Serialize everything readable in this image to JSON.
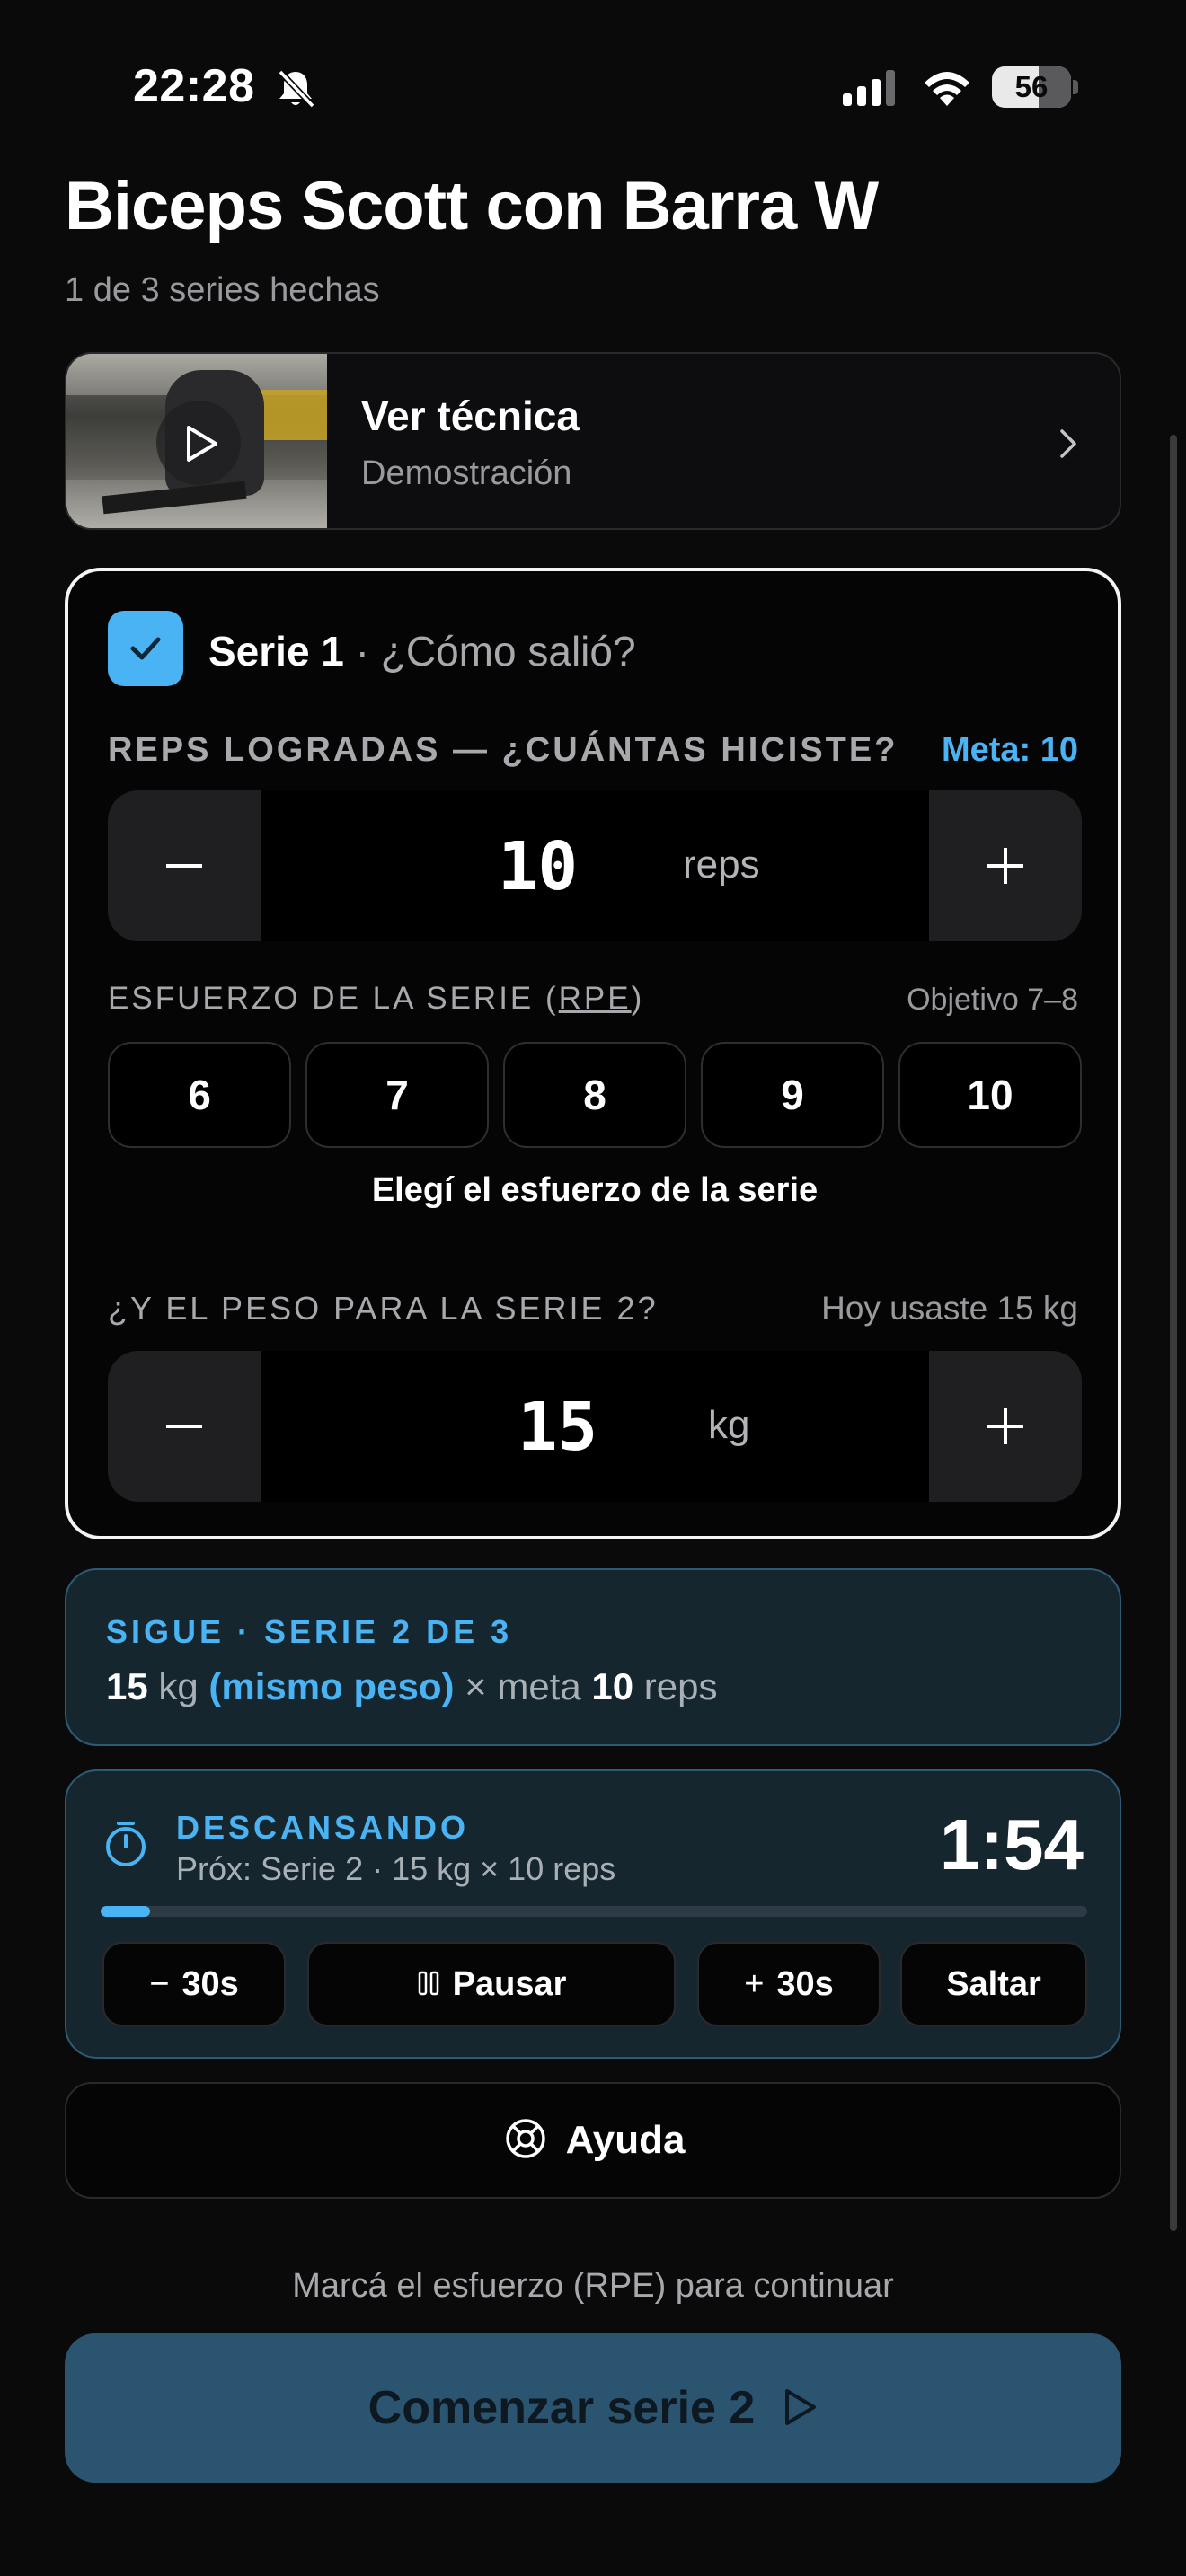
{
  "status_bar": {
    "time": "22:28",
    "battery": "56",
    "icons": [
      "bell-slash-icon",
      "signal-icon",
      "wifi-icon",
      "battery-icon"
    ]
  },
  "header": {
    "title": "Biceps Scott con Barra W",
    "subtitle": "1 de 3 series hechas"
  },
  "technique": {
    "title": "Ver técnica",
    "subtitle": "Demostración"
  },
  "series": {
    "label": "Serie 1",
    "question": " · ¿Cómo salió?",
    "reps_label": "REPS LOGRADAS — ¿CUÁNTAS HICISTE?",
    "reps_goal": "Meta: 10",
    "reps_value": "10",
    "reps_unit": "reps",
    "effort_label_start": "ESFUERZO DE LA SERIE (",
    "effort_label_rpe": "RPE",
    "effort_label_end": ")",
    "effort_objective": "Objetivo 7–8",
    "rpe_options": [
      "6",
      "7",
      "8",
      "9",
      "10"
    ],
    "effort_caption": "Elegí el esfuerzo de la serie",
    "weight_label": "¿Y EL PESO PARA LA SERIE 2?",
    "weight_hint": "Hoy usaste 15 kg",
    "weight_value": "15",
    "weight_unit": "kg"
  },
  "next": {
    "heading": "SIGUE · SERIE 2 DE 3",
    "weight": "15",
    "weight_unit": " kg ",
    "same_weight": "(mismo peso)",
    "times_goal": " × meta ",
    "reps": "10",
    "reps_unit": " reps"
  },
  "rest": {
    "heading": "DESCANSANDO",
    "next_info": "Próx: Serie 2 · 15 kg × 10 reps",
    "time": "1:54",
    "progress": 0.05,
    "buttons": {
      "minus": "30s",
      "pause": "Pausar",
      "plus": "30s",
      "skip": "Saltar"
    }
  },
  "help": {
    "label": "Ayuda"
  },
  "cta": {
    "hint": "Marcá el esfuerzo (RPE) para continuar",
    "label": "Comenzar serie 2"
  },
  "colors": {
    "accent": "#4ab3f4",
    "background": "#0a0a0b",
    "card_blue": "#16262f",
    "cta": "#2b5470"
  }
}
